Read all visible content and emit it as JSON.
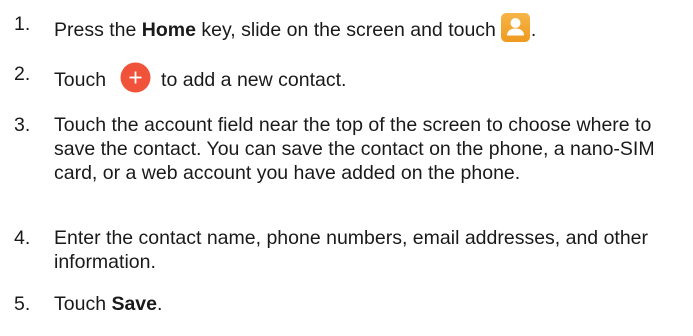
{
  "steps": [
    {
      "number": "1.",
      "before": "Press the ",
      "bold": "Home",
      "after": " key, slide on the screen and touch",
      "icon": "contacts-app-icon",
      "end": "."
    },
    {
      "number": "2.",
      "before": "Touch",
      "icon": "add-contact-plus-icon",
      "after": "to add a new contact."
    },
    {
      "number": "3.",
      "text": "Touch the account field near the top of the screen to choose where to save the contact. You can save the contact on the phone, a nano-SIM card, or a web account you have added on the phone."
    },
    {
      "number": "4.",
      "text": "Enter the contact name, phone numbers, email addresses, and other information."
    },
    {
      "number": "5.",
      "before": "Touch ",
      "bold": "Save",
      "end": "."
    }
  ],
  "colors": {
    "text": "#1a1a1a",
    "contacts_icon_bg": "#f5a623",
    "plus_button": "#f0533a"
  }
}
